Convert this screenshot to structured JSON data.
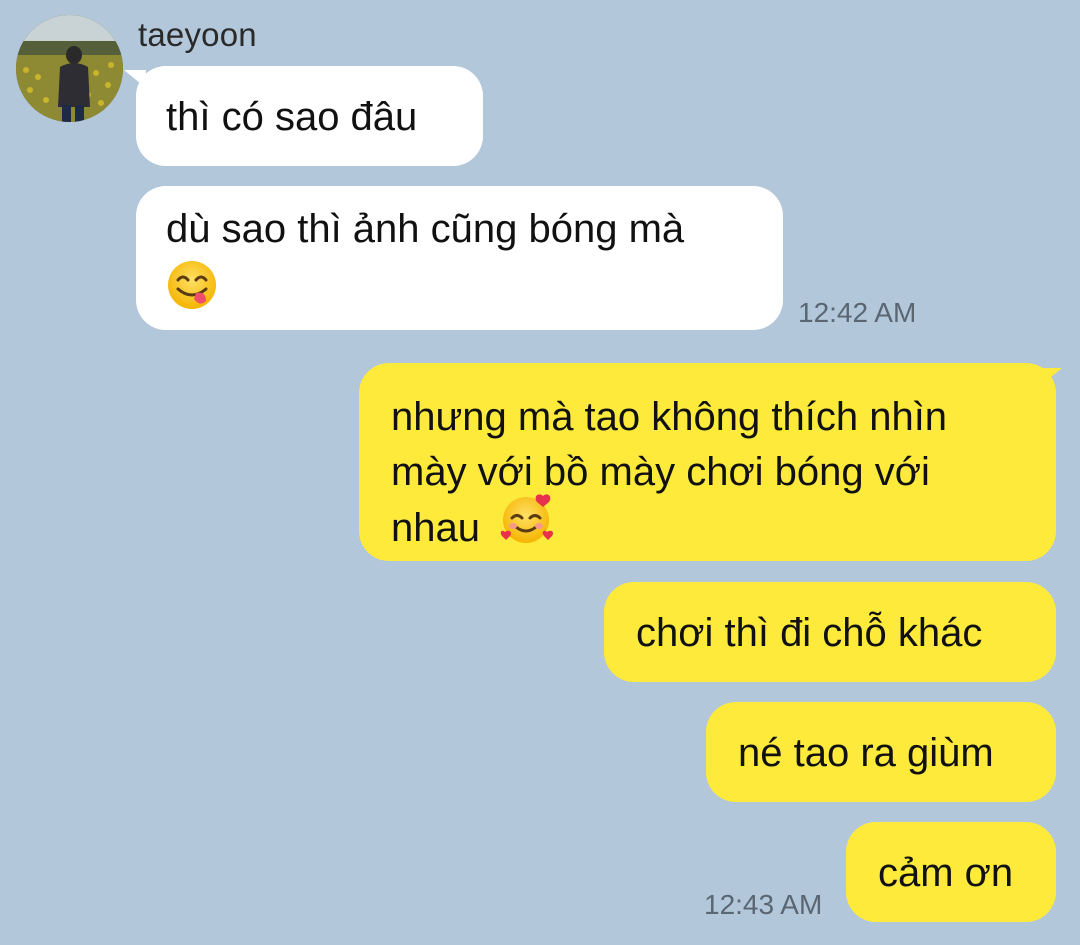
{
  "chat": {
    "contact": {
      "name": "taeyoon"
    },
    "messages": [
      {
        "id": "m1",
        "direction": "incoming",
        "text": "thì có sao đâu"
      },
      {
        "id": "m2",
        "direction": "incoming",
        "text_line1": "dù sao thì ảnh cũng bóng mà",
        "emoji": "face-savoring-food-icon",
        "timestamp": "12:42 AM"
      },
      {
        "id": "m3",
        "direction": "outgoing",
        "text_line1": "nhưng mà tao không thích nhìn",
        "text_line2": "mày với bồ mày chơi bóng với",
        "text_line3": "nhau",
        "emoji": "smiling-face-with-hearts-icon"
      },
      {
        "id": "m4",
        "direction": "outgoing",
        "text": "chơi thì đi chỗ khác"
      },
      {
        "id": "m5",
        "direction": "outgoing",
        "text": "né tao ra giùm"
      },
      {
        "id": "m6",
        "direction": "outgoing",
        "text": "cảm ơn",
        "timestamp": "12:43 AM"
      }
    ]
  },
  "colors": {
    "background": "#b2c7da",
    "incoming_bubble": "#ffffff",
    "outgoing_bubble": "#fdea3b",
    "timestamp": "#5b6673"
  }
}
